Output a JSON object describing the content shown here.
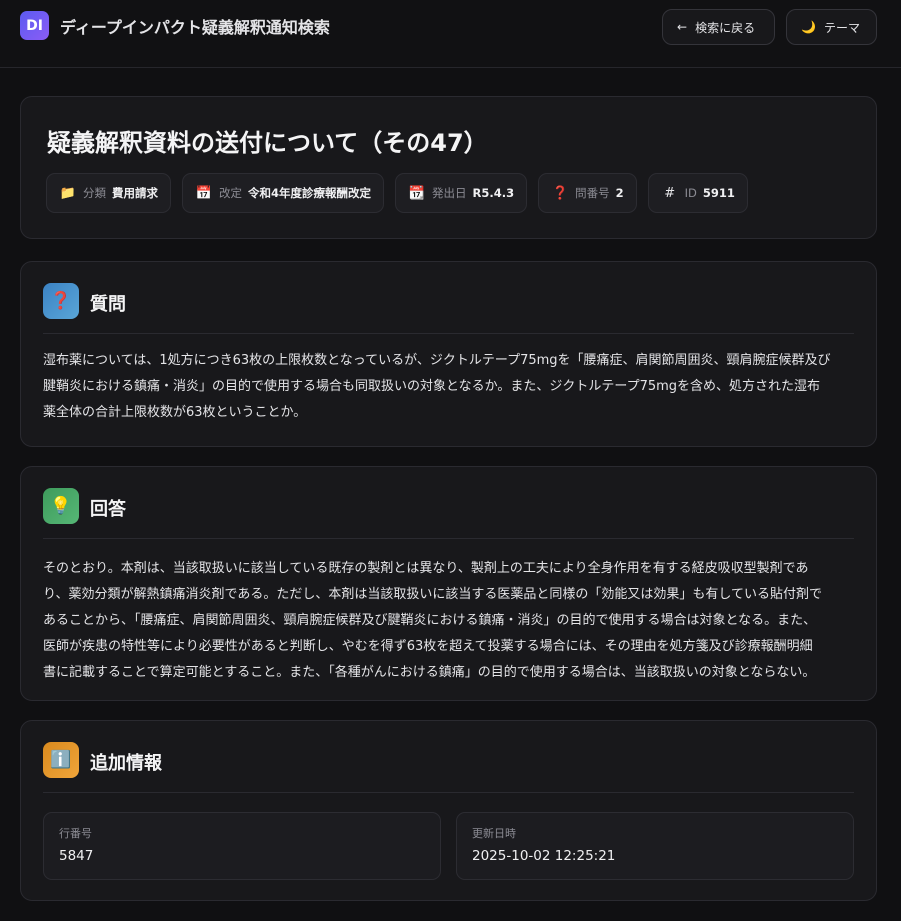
{
  "header": {
    "logo_text": "DI",
    "app_title": "ディープインパクト疑義解釈通知検索",
    "back_button": {
      "icon": "arrow-left-icon",
      "glyph": "←",
      "label": "検索に戻る"
    },
    "theme_button": {
      "icon": "moon-icon",
      "glyph": "🌙",
      "label": "テーマ"
    }
  },
  "document": {
    "title": "疑義解釈資料の送付について（その47）",
    "chips": [
      {
        "icon": "folder-icon",
        "glyph": "📁",
        "label": "分類",
        "value": "費用請求"
      },
      {
        "icon": "calendar-icon",
        "glyph": "📅",
        "label": "改定",
        "value": "令和4年度診療報酬改定"
      },
      {
        "icon": "calendar-icon",
        "glyph": "📆",
        "label": "発出日",
        "value": "R5.4.3"
      },
      {
        "icon": "question-icon",
        "glyph": "❓",
        "label": "問番号",
        "value": "2"
      },
      {
        "icon": "hash-icon",
        "glyph": "#",
        "label": "ID",
        "value": "5911"
      }
    ]
  },
  "question": {
    "icon": "question-icon",
    "glyph": "❓",
    "title": "質問",
    "lines": [
      "湿布薬については、1処方につき63枚の上限枚数となっているが、ジクトルテープ75mgを「腰痛症、肩関節周囲炎、頸肩腕症候群及び",
      "腱鞘炎における鎮痛・消炎」の目的で使用する場合も同取扱いの対象となるか。また、ジクトルテープ75mgを含め、処方された湿布",
      "薬全体の合計上限枚数が63枚ということか。"
    ]
  },
  "answer": {
    "icon": "lightbulb-icon",
    "glyph": "💡",
    "title": "回答",
    "lines": [
      "そのとおり。本剤は、当該取扱いに該当している既存の製剤とは異なり、製剤上の工夫により全身作用を有する経皮吸収型製剤であ",
      "り、薬効分類が解熱鎮痛消炎剤である。ただし、本剤は当該取扱いに該当する医薬品と同様の「効能又は効果」も有している貼付剤で",
      "あることから、「腰痛症、肩関節周囲炎、頸肩腕症候群及び腱鞘炎における鎮痛・消炎」の目的で使用する場合は対象となる。また、",
      "医師が疾患の特性等により必要性があると判断し、やむを得ず63枚を超えて投薬する場合には、その理由を処方箋及び診療報酬明細",
      "書に記載することで算定可能とすること。また、「各種がんにおける鎮痛」の目的で使用する場合は、当該取扱いの対象とならない。"
    ]
  },
  "info": {
    "icon": "info-icon",
    "glyph": "ℹ️",
    "title": "追加情報",
    "row_number_label": "行番号",
    "row_number_value": "5847",
    "updated_label": "更新日時",
    "updated_value": "2025-10-02 12:25:21"
  }
}
